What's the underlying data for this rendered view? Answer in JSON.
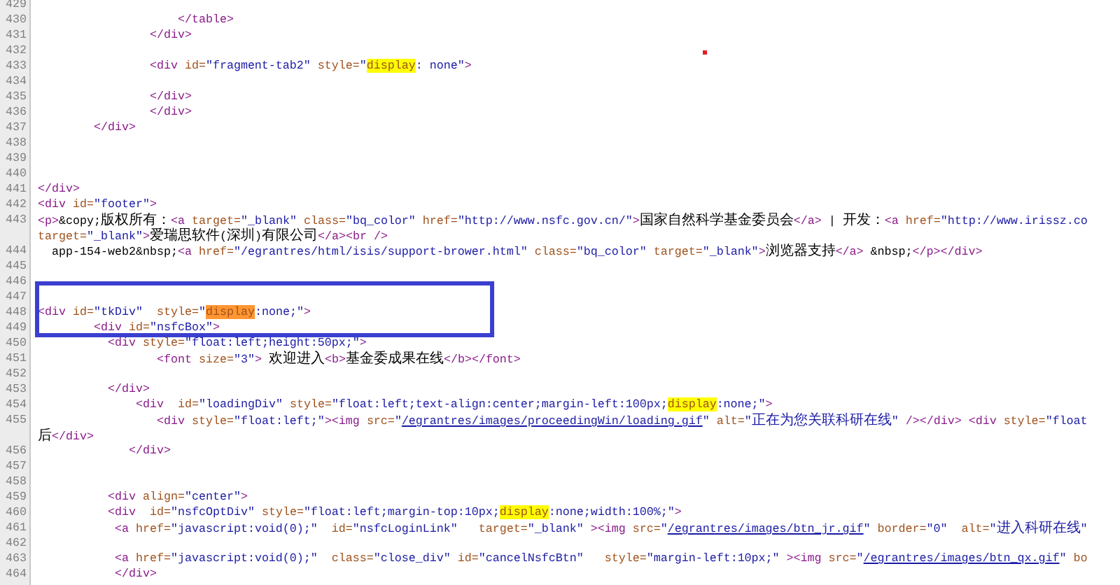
{
  "lines": [
    {
      "number": "429"
    },
    {
      "number": "430",
      "segments": [
        {
          "kind": "tag",
          "text": "                    </table>"
        }
      ]
    },
    {
      "number": "431",
      "segments": [
        {
          "kind": "tag",
          "text": "                </div>"
        }
      ]
    },
    {
      "number": "432"
    },
    {
      "number": "433",
      "segments": [
        {
          "kind": "tag",
          "text": "                <div "
        },
        {
          "kind": "attr",
          "text": "id="
        },
        {
          "kind": "value",
          "text": "\"fragment-tab2\""
        },
        {
          "kind": "attr",
          "text": " style="
        },
        {
          "kind": "value",
          "text": "\""
        },
        {
          "kind": "attr",
          "text": "display",
          "highlighted": true,
          "current": false
        },
        {
          "kind": "value",
          "text": ": none\""
        },
        {
          "kind": "tag",
          "text": ">"
        }
      ]
    },
    {
      "number": "434"
    },
    {
      "number": "435",
      "segments": [
        {
          "kind": "tag",
          "text": "                </div>"
        }
      ]
    },
    {
      "number": "436",
      "segments": [
        {
          "kind": "tag",
          "text": "                </div>"
        }
      ]
    },
    {
      "number": "437",
      "segments": [
        {
          "kind": "tag",
          "text": "        </div>"
        }
      ]
    },
    {
      "number": "438"
    },
    {
      "number": "439"
    },
    {
      "number": "440"
    },
    {
      "number": "441",
      "segments": [
        {
          "kind": "tag",
          "text": "</div>"
        }
      ]
    },
    {
      "number": "442",
      "segments": [
        {
          "kind": "tag",
          "text": "<div "
        },
        {
          "kind": "attr",
          "text": "id="
        },
        {
          "kind": "value",
          "text": "\"footer\""
        },
        {
          "kind": "tag",
          "text": ">"
        }
      ]
    },
    {
      "number": "443",
      "segments": [
        {
          "kind": "tag",
          "text": "<p>"
        },
        {
          "kind": "text",
          "text": "&copy;版权所有："
        },
        {
          "kind": "tag",
          "text": "<a "
        },
        {
          "kind": "attr",
          "text": "target="
        },
        {
          "kind": "value",
          "text": "\"_blank\""
        },
        {
          "kind": "attr",
          "text": " class="
        },
        {
          "kind": "value",
          "text": "\"bq_color\""
        },
        {
          "kind": "attr",
          "text": " href="
        },
        {
          "kind": "value",
          "text": "\"http://www.nsfc.gov.cn/\""
        },
        {
          "kind": "tag",
          "text": ">"
        },
        {
          "kind": "text",
          "text": "国家自然科学基金委员会"
        },
        {
          "kind": "tag",
          "text": "</a>"
        },
        {
          "kind": "text",
          "text": " | 开发："
        },
        {
          "kind": "tag",
          "text": "<a "
        },
        {
          "kind": "attr",
          "text": "href="
        },
        {
          "kind": "value",
          "text": "\"http://www.irissz.co"
        }
      ]
    },
    {
      "segments": [
        {
          "kind": "attr",
          "text": "target="
        },
        {
          "kind": "value",
          "text": "\"_blank\""
        },
        {
          "kind": "tag",
          "text": ">"
        },
        {
          "kind": "text",
          "text": "爱瑞思软件(深圳)有限公司"
        },
        {
          "kind": "tag",
          "text": "</a><br />"
        }
      ]
    },
    {
      "number": "444",
      "segments": [
        {
          "kind": "text",
          "text": "  app-154-web2&nbsp;"
        },
        {
          "kind": "tag",
          "text": "<a "
        },
        {
          "kind": "attr",
          "text": "href="
        },
        {
          "kind": "value",
          "text": "\"/egrantres/html/isis/support-brower.html\""
        },
        {
          "kind": "attr",
          "text": " class="
        },
        {
          "kind": "value",
          "text": "\"bq_color\""
        },
        {
          "kind": "attr",
          "text": " target="
        },
        {
          "kind": "value",
          "text": "\"_blank\""
        },
        {
          "kind": "tag",
          "text": ">"
        },
        {
          "kind": "text",
          "text": "浏览器支持"
        },
        {
          "kind": "tag",
          "text": "</a>"
        },
        {
          "kind": "text",
          "text": " &nbsp;"
        },
        {
          "kind": "tag",
          "text": "</p></div>"
        }
      ]
    },
    {
      "number": "445"
    },
    {
      "number": "446"
    },
    {
      "number": "447",
      "framed": true
    },
    {
      "number": "448",
      "framed": true,
      "segments": [
        {
          "kind": "tag",
          "text": "<div "
        },
        {
          "kind": "attr",
          "text": "id="
        },
        {
          "kind": "value",
          "text": "\"tkDiv\""
        },
        {
          "kind": "attr",
          "text": "  style="
        },
        {
          "kind": "value",
          "text": "\""
        },
        {
          "kind": "attr",
          "text": "display",
          "highlighted": true,
          "current": true
        },
        {
          "kind": "value",
          "text": ":none;\""
        },
        {
          "kind": "tag",
          "text": ">"
        }
      ]
    },
    {
      "number": "449",
      "framed": true,
      "segments": [
        {
          "kind": "tag",
          "text": "        <div "
        },
        {
          "kind": "attr",
          "text": "id="
        },
        {
          "kind": "value",
          "text": "\"nsfcBox\""
        },
        {
          "kind": "tag",
          "text": ">"
        }
      ]
    },
    {
      "number": "450",
      "segments": [
        {
          "kind": "tag",
          "text": "          <div "
        },
        {
          "kind": "attr",
          "text": "style="
        },
        {
          "kind": "value",
          "text": "\"float:left;height:50px;\""
        },
        {
          "kind": "tag",
          "text": ">"
        }
      ]
    },
    {
      "number": "451",
      "segments": [
        {
          "kind": "tag",
          "text": "                 <font "
        },
        {
          "kind": "attr",
          "text": "size="
        },
        {
          "kind": "value",
          "text": "\"3\""
        },
        {
          "kind": "tag",
          "text": ">"
        },
        {
          "kind": "text",
          "text": " 欢迎进入"
        },
        {
          "kind": "tag",
          "text": "<b>"
        },
        {
          "kind": "text",
          "text": "基金委成果在线"
        },
        {
          "kind": "tag",
          "text": "</b></font>"
        }
      ]
    },
    {
      "number": "452"
    },
    {
      "number": "453",
      "segments": [
        {
          "kind": "tag",
          "text": "          </div>"
        }
      ]
    },
    {
      "number": "454",
      "segments": [
        {
          "kind": "tag",
          "text": "              <div  "
        },
        {
          "kind": "attr",
          "text": "id="
        },
        {
          "kind": "value",
          "text": "\"loadingDiv\""
        },
        {
          "kind": "attr",
          "text": " style="
        },
        {
          "kind": "value",
          "text": "\"float:left;text-align:center;margin-left:100px;"
        },
        {
          "kind": "attr",
          "text": "display",
          "highlighted": true,
          "current": false
        },
        {
          "kind": "value",
          "text": ":none;\""
        },
        {
          "kind": "tag",
          "text": ">"
        }
      ]
    },
    {
      "number": "455",
      "segments": [
        {
          "kind": "tag",
          "text": "                 <div "
        },
        {
          "kind": "attr",
          "text": "style="
        },
        {
          "kind": "value",
          "text": "\"float:left;\""
        },
        {
          "kind": "tag",
          "text": "><img "
        },
        {
          "kind": "attr",
          "text": "src="
        },
        {
          "kind": "value",
          "text": "\""
        },
        {
          "kind": "link",
          "text": "/egrantres/images/proceedingWin/loading.gif"
        },
        {
          "kind": "value",
          "text": "\""
        },
        {
          "kind": "attr",
          "text": " alt="
        },
        {
          "kind": "value",
          "text": "\"正在为您关联科研在线\""
        },
        {
          "kind": "tag",
          "text": " /></div> <div "
        },
        {
          "kind": "attr",
          "text": "style="
        },
        {
          "kind": "value",
          "text": "\"float"
        }
      ]
    },
    {
      "segments": [
        {
          "kind": "text",
          "text": "后"
        },
        {
          "kind": "tag",
          "text": "</div>"
        }
      ]
    },
    {
      "number": "456",
      "segments": [
        {
          "kind": "tag",
          "text": "             </div>"
        }
      ]
    },
    {
      "number": "457"
    },
    {
      "number": "458"
    },
    {
      "number": "459",
      "segments": [
        {
          "kind": "tag",
          "text": "          <div "
        },
        {
          "kind": "attr",
          "text": "align="
        },
        {
          "kind": "value",
          "text": "\"center\""
        },
        {
          "kind": "tag",
          "text": ">"
        }
      ]
    },
    {
      "number": "460",
      "segments": [
        {
          "kind": "tag",
          "text": "          <div  "
        },
        {
          "kind": "attr",
          "text": "id="
        },
        {
          "kind": "value",
          "text": "\"nsfcOptDiv\""
        },
        {
          "kind": "attr",
          "text": " style="
        },
        {
          "kind": "value",
          "text": "\"float:left;margin-top:10px;"
        },
        {
          "kind": "attr",
          "text": "display",
          "highlighted": true,
          "current": false
        },
        {
          "kind": "value",
          "text": ":none;width:100%;\""
        },
        {
          "kind": "tag",
          "text": ">"
        }
      ]
    },
    {
      "number": "461",
      "segments": [
        {
          "kind": "tag",
          "text": "           <a "
        },
        {
          "kind": "attr",
          "text": "href="
        },
        {
          "kind": "value",
          "text": "\"javascript:void(0);\""
        },
        {
          "kind": "attr",
          "text": "  id="
        },
        {
          "kind": "value",
          "text": "\"nsfcLoginLink\""
        },
        {
          "kind": "attr",
          "text": "   target="
        },
        {
          "kind": "value",
          "text": "\"_blank\""
        },
        {
          "kind": "tag",
          "text": " ><img "
        },
        {
          "kind": "attr",
          "text": "src="
        },
        {
          "kind": "value",
          "text": "\""
        },
        {
          "kind": "link",
          "text": "/egrantres/images/btn_jr.gif"
        },
        {
          "kind": "value",
          "text": "\""
        },
        {
          "kind": "attr",
          "text": " border="
        },
        {
          "kind": "value",
          "text": "\"0\""
        },
        {
          "kind": "attr",
          "text": "  alt="
        },
        {
          "kind": "value",
          "text": "\"进入科研在线\""
        }
      ]
    },
    {
      "number": "462"
    },
    {
      "number": "463",
      "segments": [
        {
          "kind": "tag",
          "text": "           <a "
        },
        {
          "kind": "attr",
          "text": "href="
        },
        {
          "kind": "value",
          "text": "\"javascript:void(0);\""
        },
        {
          "kind": "attr",
          "text": "  class="
        },
        {
          "kind": "value",
          "text": "\"close_div\""
        },
        {
          "kind": "attr",
          "text": " id="
        },
        {
          "kind": "value",
          "text": "\"cancelNsfcBtn\""
        },
        {
          "kind": "attr",
          "text": "   style="
        },
        {
          "kind": "value",
          "text": "\"margin-left:10px;\""
        },
        {
          "kind": "tag",
          "text": " ><img "
        },
        {
          "kind": "attr",
          "text": "src="
        },
        {
          "kind": "value",
          "text": "\""
        },
        {
          "kind": "link",
          "text": "/egrantres/images/btn_qx.gif"
        },
        {
          "kind": "value",
          "text": "\""
        },
        {
          "kind": "attr",
          "text": " bo"
        }
      ]
    },
    {
      "number": "464",
      "segments": [
        {
          "kind": "tag",
          "text": "           </div>"
        }
      ]
    }
  ]
}
